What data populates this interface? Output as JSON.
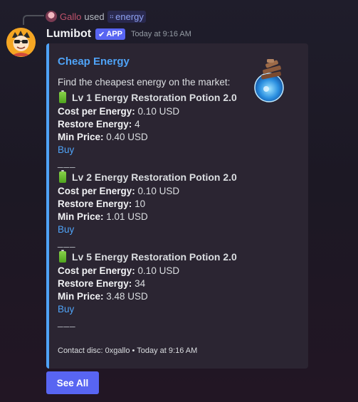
{
  "reply": {
    "user": "Gallo",
    "used_text": "used",
    "command": "energy"
  },
  "message": {
    "bot_name": "Lumibot",
    "badge": "APP",
    "timestamp": "Today at 9:16 AM"
  },
  "embed": {
    "title": "Cheap Energy",
    "description": "Find the cheapest energy on the market:",
    "accent_color": "#4fa3f7",
    "items": [
      {
        "name": "Lv 1 Energy Restoration Potion 2.0",
        "cost_label": "Cost per Energy:",
        "cost_value": "0.10 USD",
        "restore_label": "Restore Energy:",
        "restore_value": "4",
        "min_label": "Min Price:",
        "min_value": "0.40 USD",
        "buy": "Buy",
        "separator": "___"
      },
      {
        "name": "Lv 2 Energy Restoration Potion 2.0",
        "cost_label": "Cost per Energy:",
        "cost_value": "0.10 USD",
        "restore_label": "Restore Energy:",
        "restore_value": "10",
        "min_label": "Min Price:",
        "min_value": "1.01 USD",
        "buy": "Buy",
        "separator": "___"
      },
      {
        "name": "Lv 5 Energy Restoration Potion 2.0",
        "cost_label": "Cost per Energy:",
        "cost_value": "0.10 USD",
        "restore_label": "Restore Energy:",
        "restore_value": "34",
        "min_label": "Min Price:",
        "min_value": "3.48 USD",
        "buy": "Buy",
        "separator": "___"
      }
    ],
    "footer": "Contact disc: 0xgallo • Today at 9:16 AM"
  },
  "buttons": {
    "see_all": "See All"
  }
}
